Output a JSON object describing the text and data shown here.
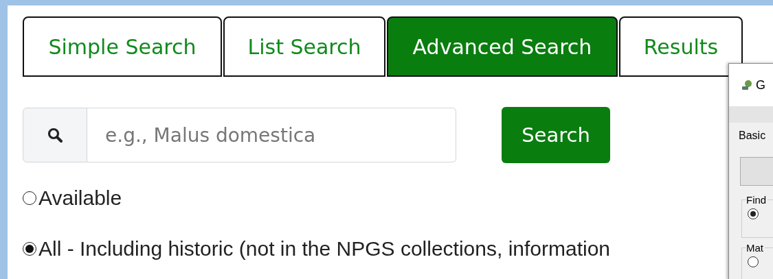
{
  "tabs": [
    {
      "label": "Simple Search",
      "selected": false
    },
    {
      "label": "List Search",
      "selected": false
    },
    {
      "label": "Advanced Search",
      "selected": true
    },
    {
      "label": "Results",
      "selected": false
    }
  ],
  "search": {
    "placeholder": "e.g., Malus domestica",
    "button": "Search"
  },
  "options": [
    {
      "label": "Available",
      "selected": false
    },
    {
      "label": "All - Including historic (not in the NPGS collections, information",
      "selected": true
    }
  ],
  "overlay_window": {
    "title": "G",
    "tab": "Basic",
    "groups": [
      {
        "label": "Find",
        "checked": true
      },
      {
        "label": "Mat",
        "checked": false
      }
    ]
  }
}
